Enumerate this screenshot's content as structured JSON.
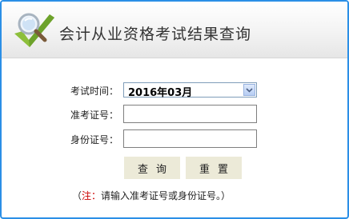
{
  "header": {
    "title": "会计从业资格考试结果查询",
    "logo_icon": "magnifier-check-icon"
  },
  "form": {
    "exam_time": {
      "label": "考试时间：",
      "selected": "2016年03月"
    },
    "ticket_number": {
      "label": "准考证号：",
      "value": ""
    },
    "id_number": {
      "label": "身份证号：",
      "value": ""
    },
    "query_button": "查询",
    "reset_button": "重置"
  },
  "note": {
    "open": "（",
    "prefix": "注：",
    "text": "请输入准考证号或身份证号。",
    "close": "）"
  },
  "colors": {
    "frame_border": "#2b8fe6",
    "button_bg": "#ecead8",
    "note_red": "#cc0000"
  }
}
